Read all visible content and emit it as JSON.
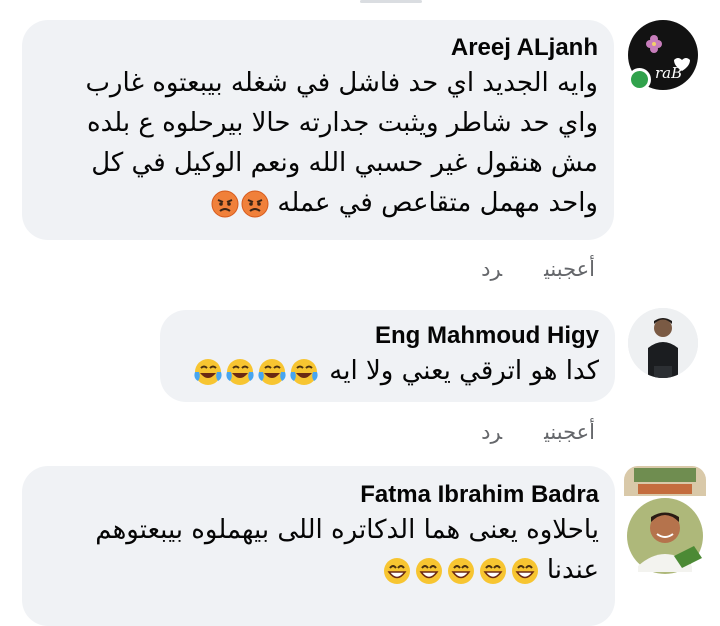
{
  "comments": [
    {
      "author": "Areej ALjanh",
      "avatar_text": "raB",
      "lines": [
        "وايه  الجديد اي حد فاشل في شغله بيبعتوه غارب",
        "واي حد شاطر ويثبت جدارته حالا بيرحلوه ع بلده",
        "مش هنقول غير حسبي الله ونعم الوكيل في كل",
        "واحد مهمل متقاعص في عمله"
      ],
      "emoji": [
        "angry-face",
        "angry-face"
      ],
      "actions": {
        "like": "أعجبني",
        "reply": "رد"
      }
    },
    {
      "author": "Eng Mahmoud Higy",
      "lines": [
        "كدا هو اترقي يعني ولا ايه"
      ],
      "emoji": [
        "laughing-tears",
        "laughing-tears",
        "laughing-tears",
        "laughing-tears"
      ],
      "actions": {
        "like": "أعجبني",
        "reply": "رد"
      }
    },
    {
      "author": "Fatma Ibrahim Badra",
      "lines": [
        "ياحلاوه يعنى هما الدكاتره اللى بيهملوه بيبعتوهم",
        "عندنا"
      ],
      "emoji": [
        "grinning-face",
        "grinning-face",
        "grinning-face",
        "grinning-face",
        "grinning-face"
      ]
    }
  ],
  "colors": {
    "bubble": "#f0f2f5",
    "action_text": "#65676b",
    "online": "#31a24c"
  }
}
